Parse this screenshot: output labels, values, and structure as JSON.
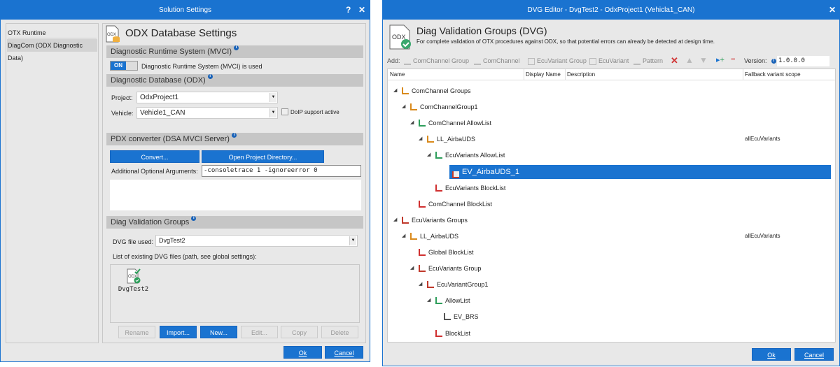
{
  "solution": {
    "title": "Solution Settings",
    "help": "?",
    "close": "✕",
    "nav": [
      "OTX Runtime",
      "DiagCom (ODX Diagnostic Data)"
    ],
    "heading": "ODX Database Settings",
    "sec_mvci": "Diagnostic Runtime System (MVCI)",
    "toggle": "ON",
    "toggle_label": "Diagnostic Runtime System (MVCI) is used",
    "sec_odx": "Diagnostic Database (ODX)",
    "project_label": "Project:",
    "project": "OdxProject1",
    "vehicle_label": "Vehicle:",
    "vehicle": "Vehicle1_CAN",
    "doip": "DoIP support active",
    "sec_pdx": "PDX converter (DSA MVCI Server)",
    "convert": "Convert...",
    "open_dir": "Open Project Directory...",
    "args_label": "Additional Optional Arguments:",
    "args": "-consoletrace 1 -ignoreerror 0",
    "sec_dvg": "Diag Validation Groups",
    "dvg_label": "DVG file used:",
    "dvg": "DvgTest2",
    "list_label": "List of existing DVG files (path, see global settings):",
    "file": "DvgTest2",
    "file_icon_text": "ODX",
    "buttons": [
      "Rename",
      "Import...",
      "New...",
      "Edit...",
      "Copy",
      "Delete"
    ],
    "ok": "Ok",
    "cancel": "Cancel"
  },
  "dvg": {
    "title": "DVG Editor - DvgTest2 - OdxProject1 (Vehicla1_CAN)",
    "close": "✕",
    "heading": "Diag Validation Groups (DVG)",
    "subtitle": "For complete validation of OTX procedures against ODX, so that potential errors can already be detected at design time.",
    "icon_text": "ODX",
    "add": "Add:",
    "toolbar": [
      "ComChannel Group",
      "ComChannel",
      "EcuVariant Group",
      "EcuVariant",
      "Pattern"
    ],
    "version_label": "Version:",
    "version": "1.0.0.0",
    "columns": [
      "Name",
      "Display Name",
      "Description",
      "Fallback variant scope"
    ],
    "tree": [
      {
        "label": "ComChannel Groups",
        "level": 0,
        "exp": true,
        "icon": "comchannel-group-icon",
        "color": "#d98a1c"
      },
      {
        "label": "ComChannelGroup1",
        "level": 1,
        "exp": true,
        "icon": "comchannel-group-icon",
        "color": "#d98a1c"
      },
      {
        "label": "ComChannel AllowList",
        "level": 2,
        "exp": true,
        "icon": "allowlist-icon",
        "color": "#2e9e5b"
      },
      {
        "label": "LL_AirbaUDS",
        "level": 3,
        "exp": true,
        "icon": "comchannel-icon",
        "color": "#d98a1c",
        "fallback": "allEcuVariants"
      },
      {
        "label": "EcuVariants AllowList",
        "level": 4,
        "exp": true,
        "icon": "ecuvariant-allowlist-icon",
        "color": "#2e9e5b"
      },
      {
        "label": "EV_AirbaUDS_1",
        "level": 5,
        "exp": false,
        "icon": "ecuvariant-icon",
        "color": "#c0392b",
        "selected": true
      },
      {
        "label": "EcuVariants BlockList",
        "level": 4,
        "exp": false,
        "icon": "ecuvariant-blocklist-icon",
        "color": "#d03030"
      },
      {
        "label": "ComChannel BlockList",
        "level": 2,
        "exp": false,
        "icon": "blocklist-icon",
        "color": "#d03030"
      },
      {
        "label": "EcuVariants Groups",
        "level": 0,
        "exp": true,
        "icon": "ecuvariant-group-icon",
        "color": "#c0392b"
      },
      {
        "label": "LL_AirbaUDS",
        "level": 1,
        "exp": true,
        "icon": "comchannel-icon",
        "color": "#d98a1c",
        "fallback": "allEcuVariants"
      },
      {
        "label": "Global BlockList",
        "level": 2,
        "exp": false,
        "icon": "blocklist-icon",
        "color": "#d03030"
      },
      {
        "label": "EcuVariants Group",
        "level": 2,
        "exp": true,
        "icon": "ecuvariant-group-icon",
        "color": "#c0392b"
      },
      {
        "label": "EcuVariantGroup1",
        "level": 3,
        "exp": true,
        "icon": "ecuvariant-group-icon",
        "color": "#c0392b"
      },
      {
        "label": "AllowList",
        "level": 4,
        "exp": true,
        "icon": "allowlist-icon",
        "color": "#2e9e5b"
      },
      {
        "label": "EV_BRS",
        "level": 5,
        "exp": false,
        "icon": "ecuvariant-icon",
        "color": "#555"
      },
      {
        "label": "BlockList",
        "level": 4,
        "exp": false,
        "icon": "blocklist-icon",
        "color": "#d03030"
      }
    ],
    "ok": "Ok",
    "cancel": "Cancel"
  }
}
